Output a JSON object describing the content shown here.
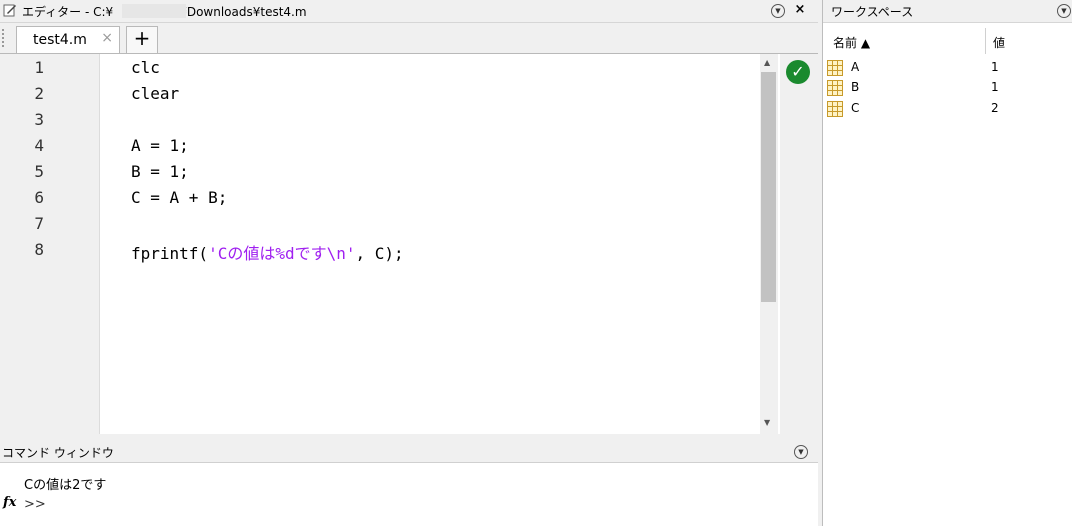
{
  "editor": {
    "title_prefix": "エディター - C:¥",
    "title_suffix": "¥Downloads¥test4.m",
    "tab_label": "test4.m",
    "add_tab": "+",
    "close_glyph": "×",
    "lines": [
      {
        "n": "1",
        "code": "clc"
      },
      {
        "n": "2",
        "code": "clear"
      },
      {
        "n": "3",
        "code": ""
      },
      {
        "n": "4",
        "code": "A = 1;"
      },
      {
        "n": "5",
        "code": "B = 1;"
      },
      {
        "n": "6",
        "code": "C = A + B;"
      },
      {
        "n": "7",
        "code": ""
      },
      {
        "n": "8",
        "code_pre": "fprintf(",
        "code_str": "'Cの値は%dです\\n'",
        "code_post": ", C);"
      }
    ]
  },
  "command_window": {
    "title": "コマンド ウィンドウ",
    "output": "Cの値は2です",
    "prompt": ">>",
    "fx": "fx"
  },
  "workspace": {
    "title": "ワークスペース",
    "col_name": "名前 ▲",
    "col_value": "値",
    "rows": [
      {
        "name": "A",
        "value": "1"
      },
      {
        "name": "B",
        "value": "1"
      },
      {
        "name": "C",
        "value": "2"
      }
    ]
  },
  "colors": {
    "string": "#a020f0",
    "ok": "#1a8a2e"
  }
}
